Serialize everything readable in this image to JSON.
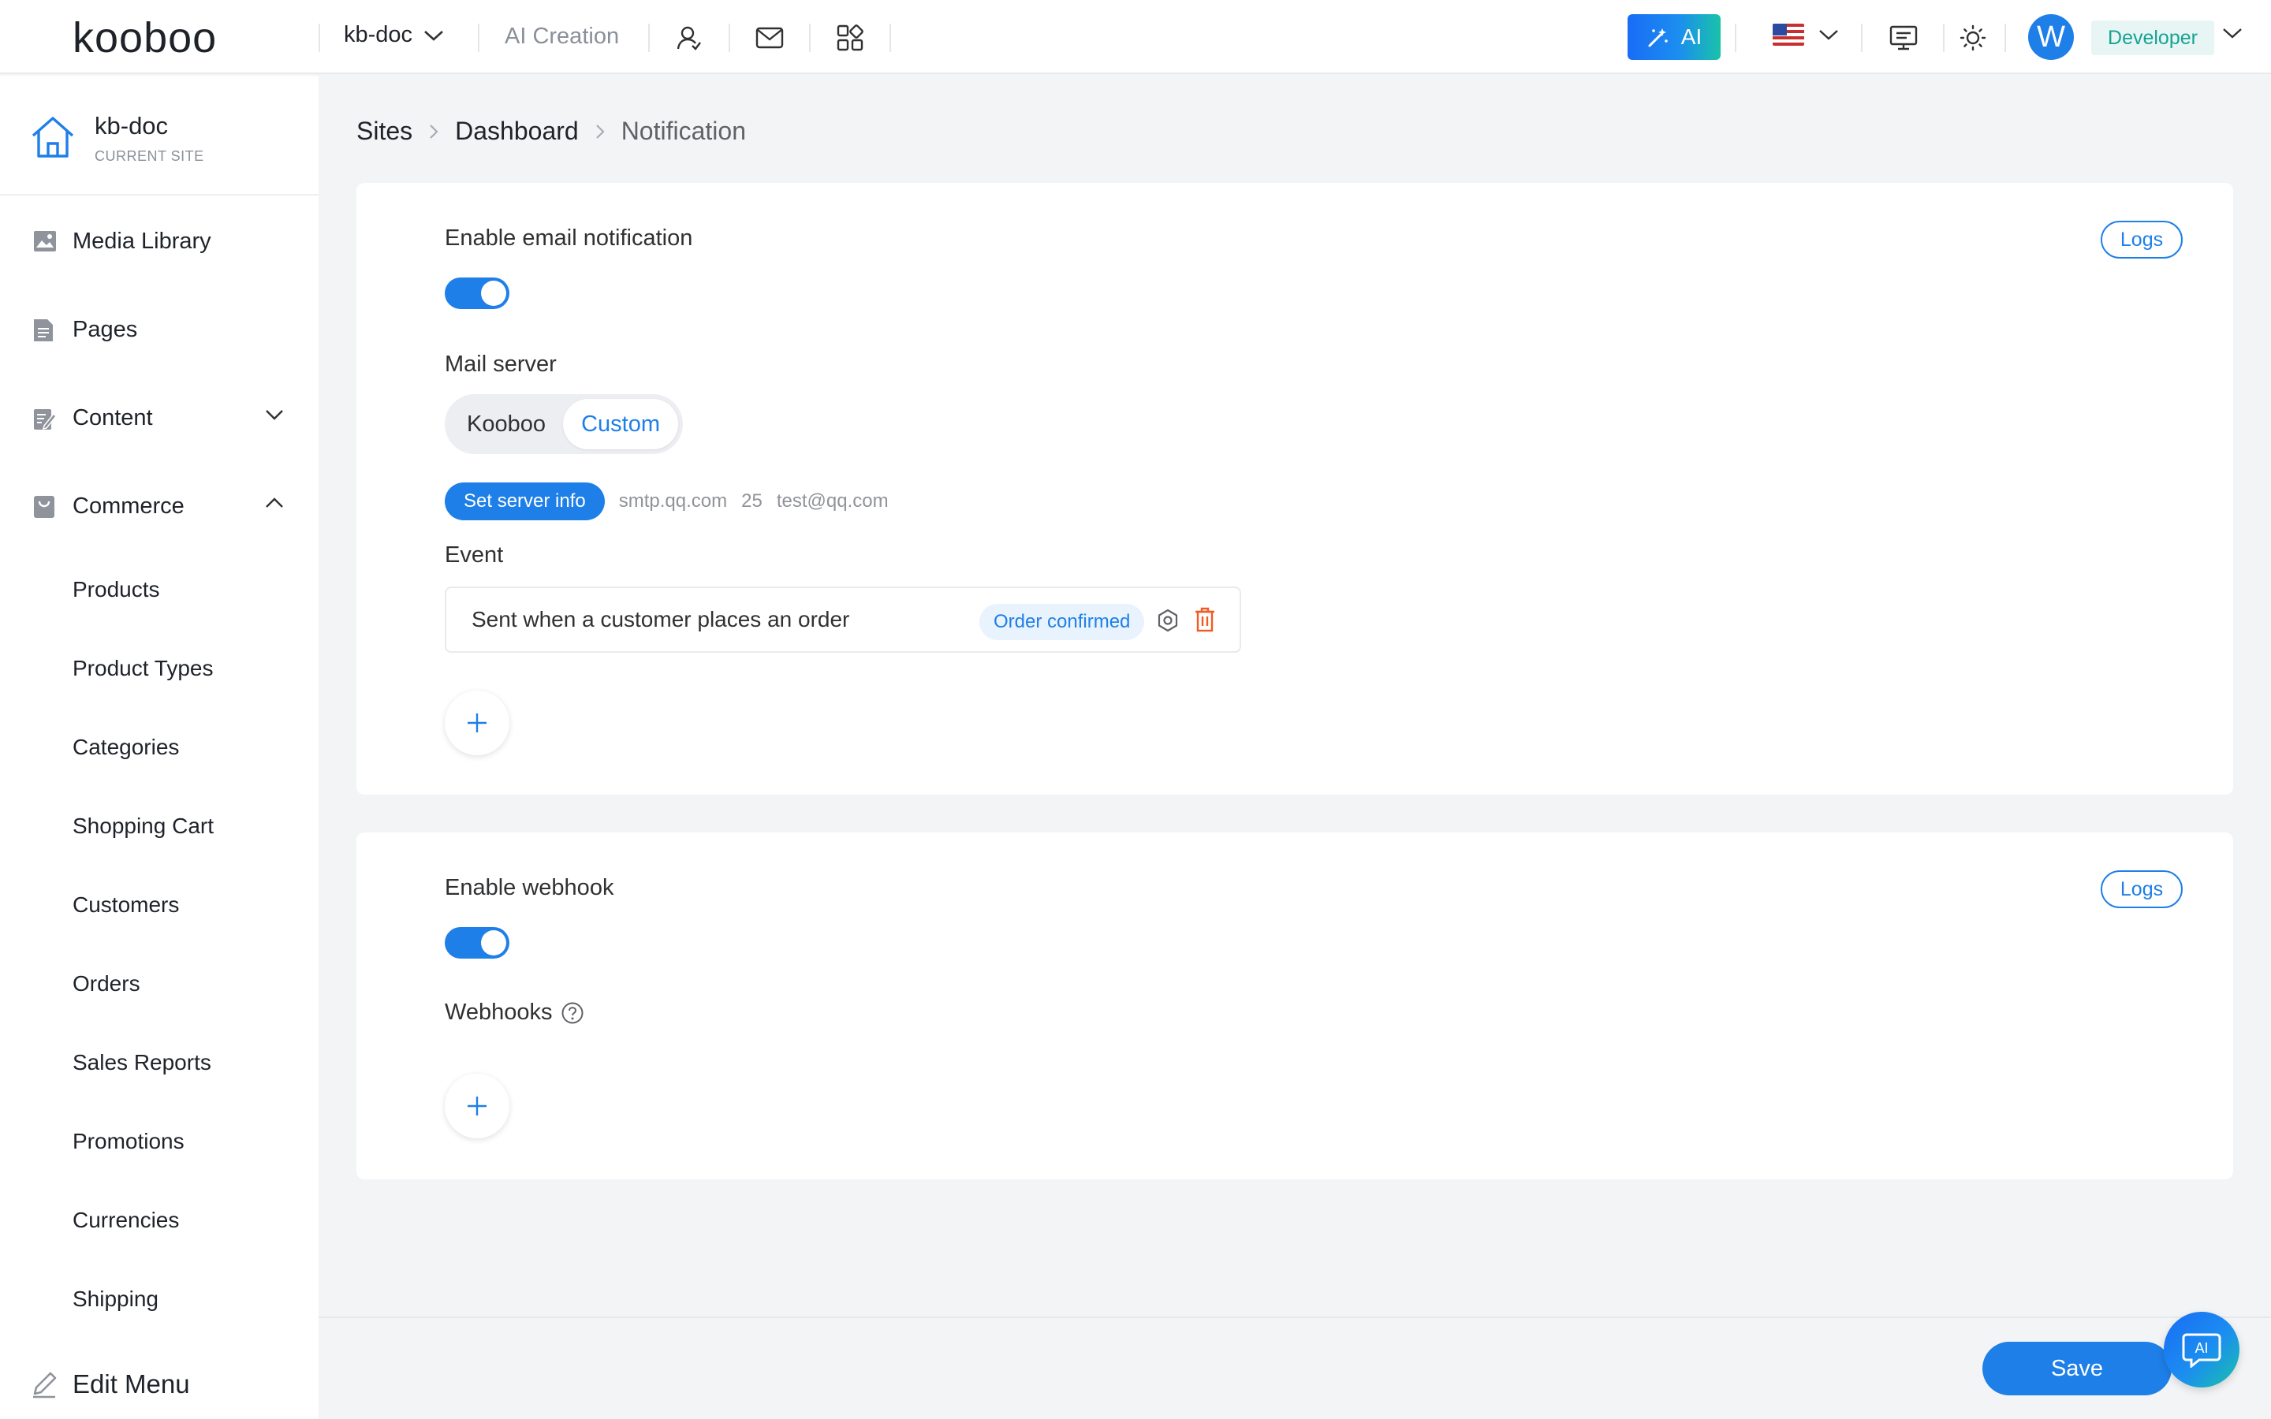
{
  "header": {
    "logo_text": "kooboo",
    "site": "kb-doc",
    "ai_creation": "AI Creation",
    "ai_button": "AI",
    "avatar_letter": "W",
    "role": "Developer",
    "icons": [
      "user-icon",
      "mail-icon",
      "apps-icon",
      "monitor-icon",
      "sun-icon"
    ]
  },
  "sidebar": {
    "current_site": {
      "name": "kb-doc",
      "label": "CURRENT SITE"
    },
    "items": [
      {
        "label": "Media Library",
        "icon": "image-icon"
      },
      {
        "label": "Pages",
        "icon": "page-icon"
      },
      {
        "label": "Content",
        "icon": "edit-doc-icon",
        "expanded": false
      },
      {
        "label": "Commerce",
        "icon": "bag-icon",
        "expanded": true
      }
    ],
    "commerce_items": [
      "Products",
      "Product Types",
      "Categories",
      "Shopping Cart",
      "Customers",
      "Orders",
      "Sales Reports",
      "Promotions",
      "Currencies",
      "Shipping"
    ],
    "edit_menu": "Edit Menu"
  },
  "breadcrumb": [
    "Sites",
    "Dashboard",
    "Notification"
  ],
  "email": {
    "title": "Enable email notification",
    "logs": "Logs",
    "enabled": true,
    "mail_server_label": "Mail server",
    "mail_server_options": [
      "Kooboo",
      "Custom"
    ],
    "mail_server_selected": "Custom",
    "set_server_button": "Set server info",
    "server_host": "smtp.qq.com",
    "server_port": "25",
    "server_email": "test@qq.com",
    "event_label": "Event",
    "events": [
      {
        "description": "Sent when a customer places an order",
        "tag": "Order confirmed"
      }
    ]
  },
  "webhook": {
    "title": "Enable webhook",
    "logs": "Logs",
    "enabled": true,
    "webhooks_label": "Webhooks"
  },
  "footer": {
    "save": "Save",
    "ai_chat": "AI"
  },
  "colors": {
    "primary": "#1e7fe8",
    "delete": "#f05a24",
    "teal": "#16a394"
  }
}
